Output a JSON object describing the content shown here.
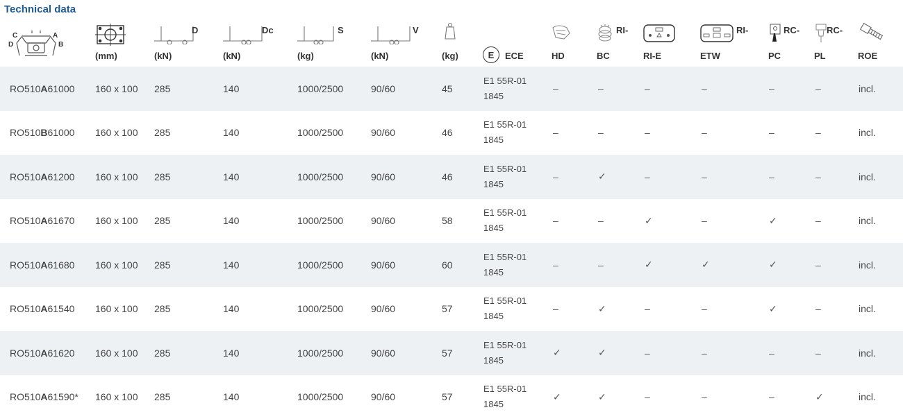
{
  "title": "Technical data",
  "header": {
    "mm": "(mm)",
    "d_unit": "(kN)",
    "d_label": "D",
    "dc_unit": "(kN)",
    "dc_label": "Dc",
    "s_unit": "(kg)",
    "s_label": "S",
    "v_unit": "(kN)",
    "v_label": "V",
    "weight_unit": "(kg)",
    "ece_label": "ECE",
    "ece_mark": "E",
    "hd": "HD",
    "ri_bc_top": "RI-",
    "ri_bc_bottom": "BC",
    "ri_e": "RI-E",
    "ri_etw_top": "RI-",
    "ri_etw_bottom": "ETW",
    "rc_pc_top": "RC-",
    "rc_pc_bottom": "PC",
    "rc_pl_top": "RC-",
    "rc_pl_bottom": "PL",
    "roe": "ROE",
    "dim_labels": {
      "c": "C",
      "a": "A",
      "d": "D",
      "b": "B"
    }
  },
  "rows": [
    {
      "prefix": "RO510",
      "variant": "A",
      "suffix": "61000",
      "size": "160 x 100",
      "d": "285",
      "dc": "140",
      "s": "1000/2500",
      "v": "90/60",
      "kg": "45",
      "ece1": "E1 55R-01",
      "ece2": "1845",
      "hd": "–",
      "ribc": "–",
      "rie": "–",
      "rietw": "–",
      "rcpc": "–",
      "rcpl": "–",
      "roe": "incl."
    },
    {
      "prefix": "RO510",
      "variant": "B",
      "suffix": "61000",
      "size": "160 x 100",
      "d": "285",
      "dc": "140",
      "s": "1000/2500",
      "v": "90/60",
      "kg": "46",
      "ece1": "E1 55R-01",
      "ece2": "1845",
      "hd": "–",
      "ribc": "–",
      "rie": "–",
      "rietw": "–",
      "rcpc": "–",
      "rcpl": "–",
      "roe": "incl."
    },
    {
      "prefix": "RO510",
      "variant": "A",
      "suffix": "61200",
      "size": "160 x 100",
      "d": "285",
      "dc": "140",
      "s": "1000/2500",
      "v": "90/60",
      "kg": "46",
      "ece1": "E1 55R-01",
      "ece2": "1845",
      "hd": "–",
      "ribc": "✓",
      "rie": "–",
      "rietw": "–",
      "rcpc": "–",
      "rcpl": "–",
      "roe": "incl."
    },
    {
      "prefix": "RO510",
      "variant": "A",
      "suffix": "61670",
      "size": "160 x 100",
      "d": "285",
      "dc": "140",
      "s": "1000/2500",
      "v": "90/60",
      "kg": "58",
      "ece1": "E1 55R-01",
      "ece2": "1845",
      "hd": "–",
      "ribc": "–",
      "rie": "✓",
      "rietw": "–",
      "rcpc": "✓",
      "rcpl": "–",
      "roe": "incl."
    },
    {
      "prefix": "RO510",
      "variant": "A",
      "suffix": "61680",
      "size": "160 x 100",
      "d": "285",
      "dc": "140",
      "s": "1000/2500",
      "v": "90/60",
      "kg": "60",
      "ece1": "E1 55R-01",
      "ece2": "1845",
      "hd": "–",
      "ribc": "–",
      "rie": "✓",
      "rietw": "✓",
      "rcpc": "✓",
      "rcpl": "–",
      "roe": "incl."
    },
    {
      "prefix": "RO510",
      "variant": "A",
      "suffix": "61540",
      "size": "160 x 100",
      "d": "285",
      "dc": "140",
      "s": "1000/2500",
      "v": "90/60",
      "kg": "57",
      "ece1": "E1 55R-01",
      "ece2": "1845",
      "hd": "–",
      "ribc": "✓",
      "rie": "–",
      "rietw": "–",
      "rcpc": "✓",
      "rcpl": "–",
      "roe": "incl."
    },
    {
      "prefix": "RO510",
      "variant": "A",
      "suffix": "61620",
      "size": "160 x 100",
      "d": "285",
      "dc": "140",
      "s": "1000/2500",
      "v": "90/60",
      "kg": "57",
      "ece1": "E1 55R-01",
      "ece2": "1845",
      "hd": "✓",
      "ribc": "✓",
      "rie": "–",
      "rietw": "–",
      "rcpc": "–",
      "rcpl": "–",
      "roe": "incl."
    },
    {
      "prefix": "RO510",
      "variant": "A",
      "suffix": "61590*",
      "size": "160 x 100",
      "d": "285",
      "dc": "140",
      "s": "1000/2500",
      "v": "90/60",
      "kg": "57",
      "ece1": "E1 55R-01",
      "ece2": "1845",
      "hd": "✓",
      "ribc": "✓",
      "rie": "–",
      "rietw": "–",
      "rcpc": "–",
      "rcpl": "✓",
      "roe": "incl."
    }
  ],
  "colors": {
    "title": "#1d5a92",
    "row_shade": "#eef1f4",
    "text": "#444444"
  }
}
